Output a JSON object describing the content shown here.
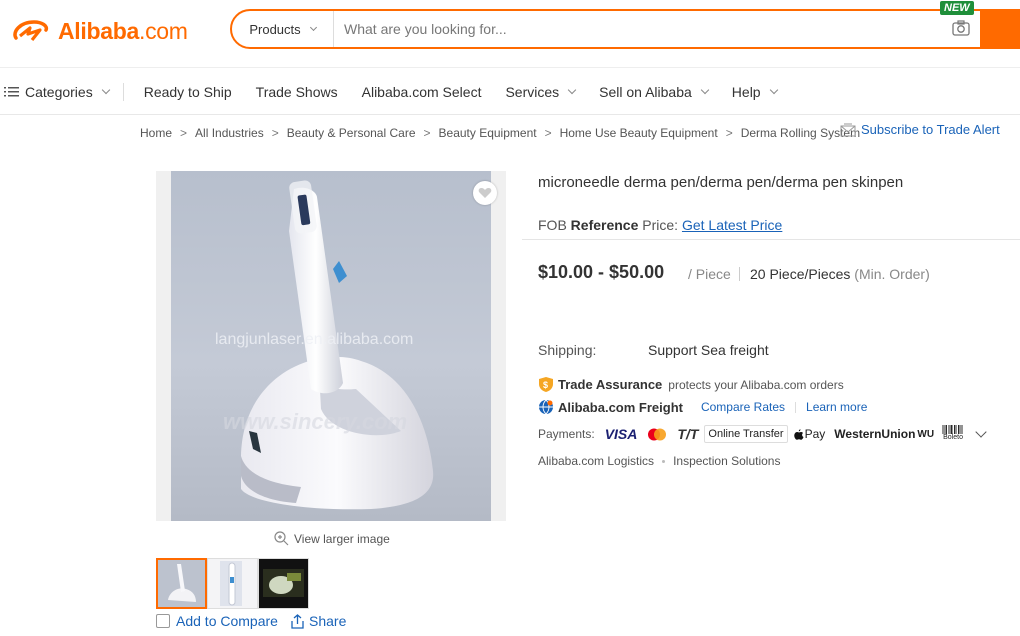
{
  "header": {
    "logo_text": "Alibaba",
    "logo_domain": ".com",
    "search_category": "Products",
    "search_placeholder": "What are you looking for...",
    "new_badge": "NEW"
  },
  "nav": {
    "categories": "Categories",
    "items": [
      "Ready to Ship",
      "Trade Shows",
      "Alibaba.com Select",
      "Services",
      "Sell on Alibaba",
      "Help"
    ]
  },
  "breadcrumb": [
    "Home",
    "All Industries",
    "Beauty & Personal Care",
    "Beauty Equipment",
    "Home Use Beauty Equipment",
    "Derma Rolling System"
  ],
  "subscribe_label": "Subscribe to Trade Alert",
  "gallery": {
    "watermark_main": "langjunlaser.en.alibaba.com",
    "watermark_secondary": "www.sincery.com",
    "view_larger": "View larger image",
    "add_to_compare": "Add to Compare",
    "share": "Share"
  },
  "product": {
    "title": "microneedle derma pen/derma pen/derma pen skinpen",
    "fob_prefix": "FOB ",
    "fob_bold": "Reference",
    "fob_suffix": " Price:",
    "fob_link": "Get Latest Price",
    "price_range": "$10.00 - $50.00",
    "unit": "/ Piece",
    "moq": "20 Piece/Pieces",
    "moq_note": "(Min. Order)",
    "shipping_label": "Shipping:",
    "shipping_value": "Support Sea freight",
    "trade_assurance_title": "Trade Assurance",
    "trade_assurance_text": "protects your Alibaba.com orders",
    "freight_title": "Alibaba.com Freight",
    "freight_links": [
      "Compare Rates",
      "Learn more"
    ],
    "payments_label": "Payments:",
    "payments": [
      "VISA",
      "T/T",
      "Online Transfer",
      "Pay",
      "WesternUnion",
      "WU",
      "Boleto"
    ],
    "extras": [
      "Alibaba.com Logistics",
      "Inspection Solutions"
    ]
  },
  "colors": {
    "brand": "#ff6a00",
    "link": "#1a63b8",
    "new_badge": "#1f8f3a"
  }
}
